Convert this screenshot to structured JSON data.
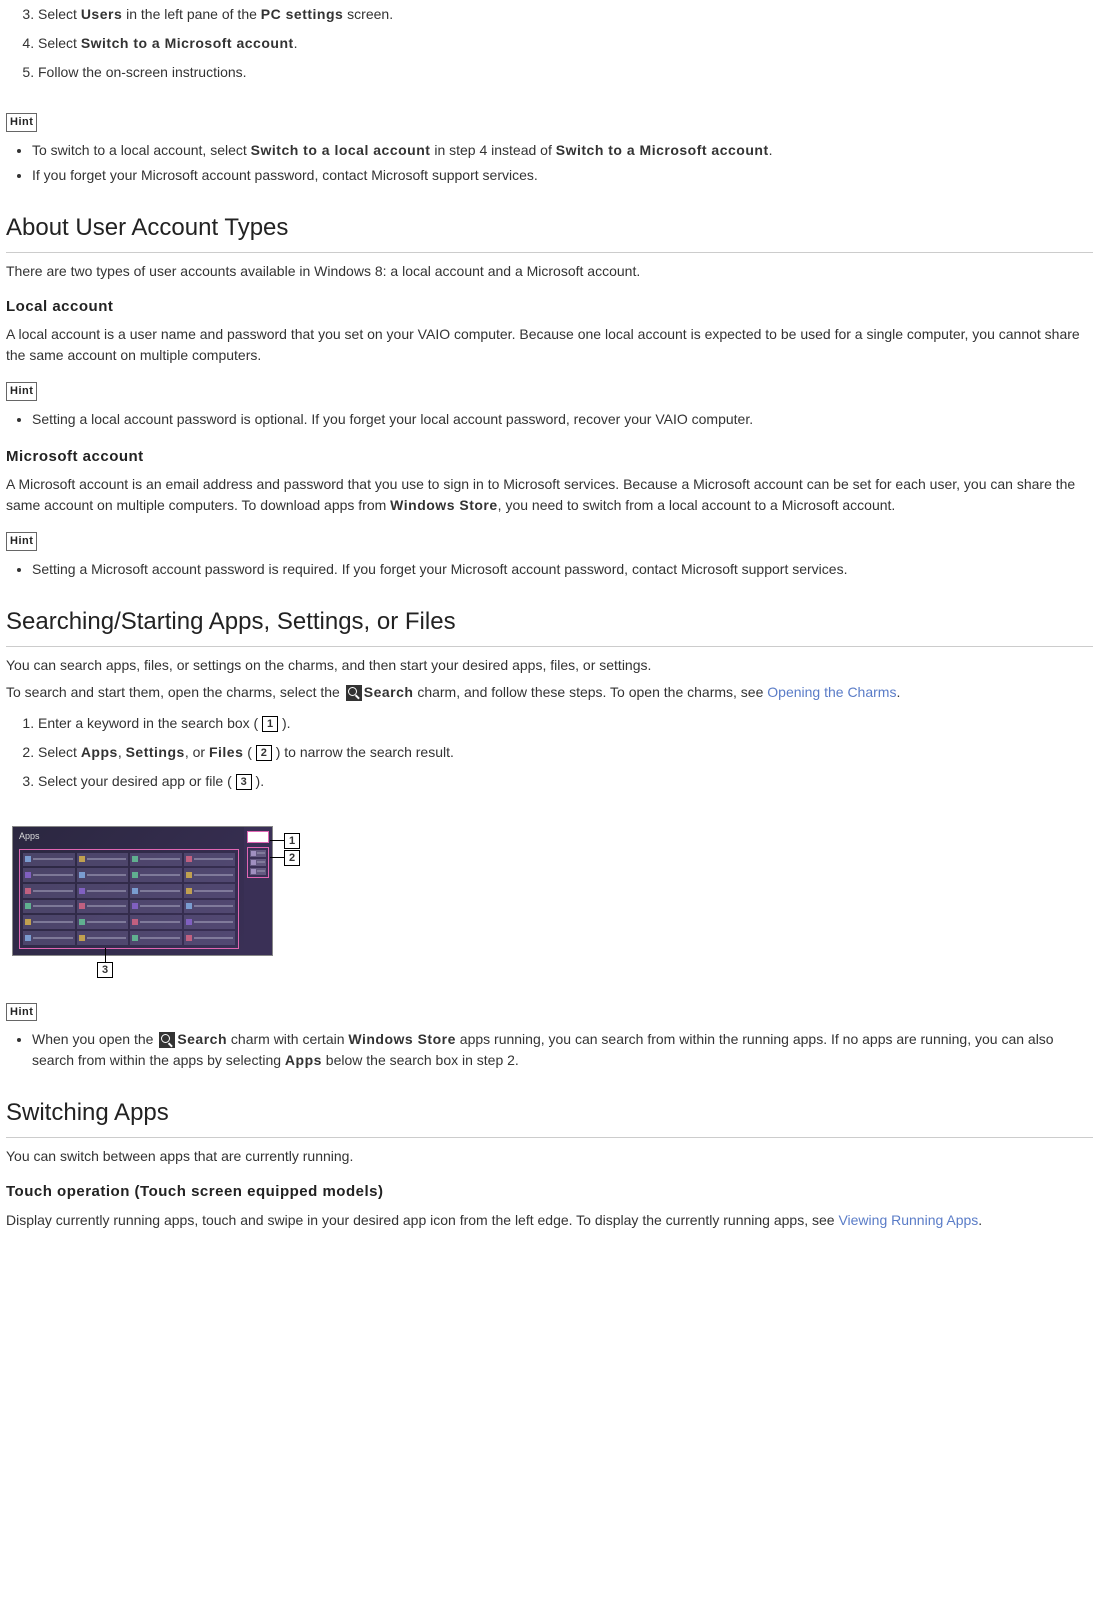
{
  "steps_a": {
    "s3_pre": "Select ",
    "s3_b1": "Users",
    "s3_mid": " in the left pane of the ",
    "s3_b2": "PC settings",
    "s3_post": " screen.",
    "s4_pre": "Select ",
    "s4_b1": "Switch to a Microsoft account",
    "s4_post": ".",
    "s5": "Follow the on-screen instructions."
  },
  "hint_label": "Hint",
  "hint_a": {
    "i1_pre": "To switch to a local account, select ",
    "i1_b1": "Switch to a local account",
    "i1_mid": " in step 4 instead of ",
    "i1_b2": "Switch to a Microsoft account",
    "i1_post": ".",
    "i2": "If you forget your Microsoft account password, contact Microsoft support services."
  },
  "h_about": "About User Account Types",
  "about_intro": "There are two types of user accounts available in Windows 8: a local account and a Microsoft account.",
  "h_local": "Local account",
  "local_desc": "A local account is a user name and password that you set on your VAIO computer. Because one local account is expected to be used for a single computer, you cannot share the same account on multiple computers.",
  "hint_local": {
    "i1": "Setting a local account password is optional. If you forget your local account password, recover your VAIO computer."
  },
  "h_ms": "Microsoft account",
  "ms_desc_pre": "A Microsoft account is an email address and password that you use to sign in to Microsoft services. Because a Microsoft account can be set for each user, you can share the same account on multiple computers. To download apps from ",
  "ms_desc_b1": "Windows Store",
  "ms_desc_post": ", you need to switch from a local account to a Microsoft account.",
  "hint_ms": {
    "i1": "Setting a Microsoft account password is required. If you forget your Microsoft account password, contact Microsoft support services."
  },
  "h_search": "Searching/Starting Apps, Settings, or Files",
  "search_p1": "You can search apps, files, or settings on the charms, and then start your desired apps, files, or settings.",
  "search_p2_pre": "To search and start them, open the charms, select the ",
  "search_p2_b1": "Search",
  "search_p2_mid": " charm, and follow these steps. To open the charms, see ",
  "link_opening": "Opening the Charms",
  "search_p2_post": ".",
  "steps_b": {
    "s1_pre": "Enter a keyword in the search box ( ",
    "s1_post": " ).",
    "s2_pre": "Select ",
    "s2_b1": "Apps",
    "s2_mid1": ", ",
    "s2_b2": "Settings",
    "s2_mid2": ", or ",
    "s2_b3": "Files",
    "s2_mid3": " ( ",
    "s2_post": " ) to narrow the search result.",
    "s3_pre": "Select your desired app or file ( ",
    "s3_post": " )."
  },
  "nums": {
    "n1": "1",
    "n2": "2",
    "n3": "3"
  },
  "fig_apps": "Apps",
  "hint_search": {
    "i1_pre": "When you open the ",
    "i1_b1": "Search",
    "i1_mid1": " charm with certain ",
    "i1_b2": "Windows Store",
    "i1_mid2": " apps running, you can search from within the running apps. If no apps are running, you can also search from within the apps by selecting ",
    "i1_b3": "Apps",
    "i1_post": " below the search box in step 2."
  },
  "h_switch": "Switching Apps",
  "switch_p1": "You can switch between apps that are currently running.",
  "h_touch": "Touch operation (Touch screen equipped models)",
  "touch_p1_pre": "Display currently running apps, touch and swipe in your desired app icon from the left edge. To display the currently running apps, see ",
  "link_viewing": "Viewing Running Apps",
  "touch_p1_post": "."
}
